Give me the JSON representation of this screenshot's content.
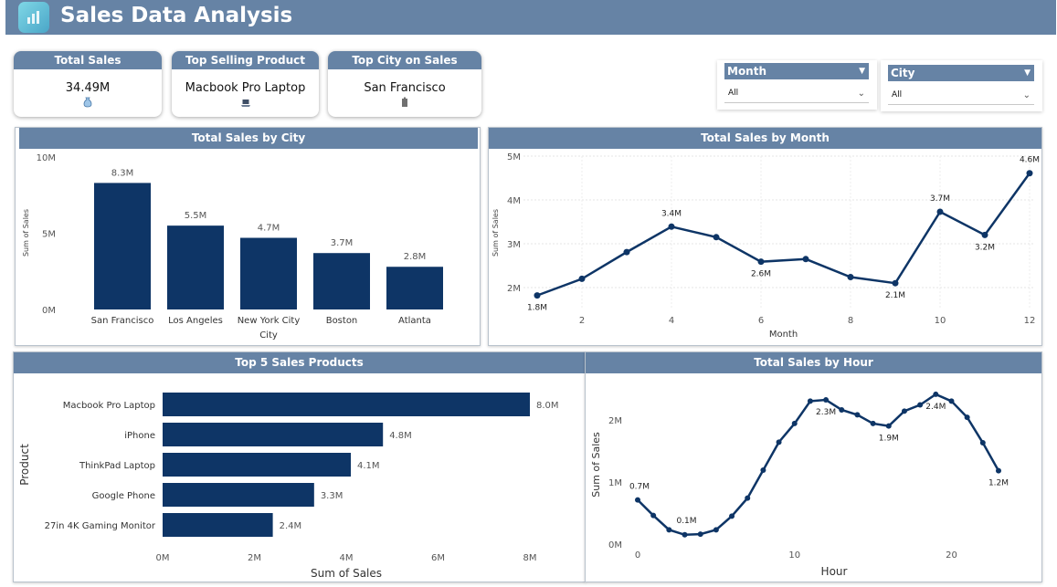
{
  "header": {
    "title": "Sales Data Analysis",
    "logo_icon": "analytics-logo-icon"
  },
  "kpis": [
    {
      "title": "Total Sales",
      "value": "34.49M",
      "icon": "money-bag-icon"
    },
    {
      "title": "Top Selling Product",
      "value": "Macbook Pro Laptop",
      "icon": "laptop-icon"
    },
    {
      "title": "Top City on Sales",
      "value": "San Francisco",
      "icon": "building-icon"
    }
  ],
  "filters": {
    "month": {
      "label": "Month",
      "value": "All"
    },
    "city": {
      "label": "City",
      "value": "All"
    }
  },
  "colors": {
    "header": "#6683a5",
    "bar": "#0e3566",
    "line": "#0e3566"
  },
  "chart_data": [
    {
      "type": "bar",
      "title": "Total Sales by City",
      "xlabel": "City",
      "ylabel": "Sum of Sales",
      "categories": [
        "San Francisco",
        "Los Angeles",
        "New York City",
        "Boston",
        "Atlanta"
      ],
      "values": [
        8.3,
        5.5,
        4.7,
        3.7,
        2.8
      ],
      "data_labels": [
        "8.3M",
        "5.5M",
        "4.7M",
        "3.7M",
        "2.8M"
      ],
      "ylim": [
        0,
        10
      ],
      "yticks": [
        0,
        5,
        10
      ],
      "ytick_labels": [
        "0M",
        "5M",
        "10M"
      ]
    },
    {
      "type": "line",
      "title": "Total Sales by Month",
      "xlabel": "Month",
      "ylabel": "Sum of Sales",
      "x": [
        1,
        2,
        3,
        4,
        5,
        6,
        7,
        8,
        9,
        10,
        11,
        12
      ],
      "values": [
        1.82,
        2.2,
        2.81,
        3.39,
        3.15,
        2.59,
        2.65,
        2.24,
        2.1,
        3.73,
        3.2,
        4.61
      ],
      "point_labels": {
        "1": "1.8M",
        "4": "3.4M",
        "6": "2.6M",
        "9": "2.1M",
        "10": "3.7M",
        "11": "3.2M",
        "12": "4.6M"
      },
      "xticks": [
        2,
        4,
        6,
        8,
        10,
        12
      ],
      "yticks": [
        2,
        3,
        4,
        5
      ],
      "ytick_labels": [
        "2M",
        "3M",
        "4M",
        "5M"
      ],
      "xlim": [
        1,
        12
      ],
      "ylim": [
        1.5,
        5
      ]
    },
    {
      "type": "bar",
      "orientation": "horizontal",
      "title": "Top 5 Sales Products",
      "xlabel": "Sum of Sales",
      "ylabel": "Product",
      "categories": [
        "Macbook Pro Laptop",
        "iPhone",
        "ThinkPad Laptop",
        "Google Phone",
        "27in 4K Gaming Monitor"
      ],
      "values": [
        8.0,
        4.8,
        4.1,
        3.3,
        2.4
      ],
      "data_labels": [
        "8.0M",
        "4.8M",
        "4.1M",
        "3.3M",
        "2.4M"
      ],
      "xlim": [
        0,
        8
      ],
      "xticks": [
        0,
        2,
        4,
        6,
        8
      ],
      "xtick_labels": [
        "0M",
        "2M",
        "4M",
        "6M",
        "8M"
      ]
    },
    {
      "type": "line",
      "title": "Total Sales by Hour",
      "xlabel": "Hour",
      "ylabel": "Sum of Sales",
      "x": [
        0,
        1,
        2,
        3,
        4,
        5,
        6,
        7,
        8,
        9,
        10,
        11,
        12,
        13,
        14,
        15,
        16,
        17,
        18,
        19,
        20,
        21,
        22,
        23
      ],
      "values": [
        0.71,
        0.46,
        0.23,
        0.15,
        0.16,
        0.23,
        0.45,
        0.74,
        1.19,
        1.64,
        1.94,
        2.3,
        2.32,
        2.16,
        2.08,
        1.94,
        1.9,
        2.14,
        2.24,
        2.41,
        2.3,
        2.04,
        1.63,
        1.18
      ],
      "point_labels": {
        "0": "0.7M",
        "3": "0.1M",
        "12": "2.3M",
        "16": "1.9M",
        "19": "2.4M",
        "23": "1.2M"
      },
      "xticks": [
        0,
        10,
        20
      ],
      "yticks": [
        0,
        1,
        2
      ],
      "ytick_labels": [
        "0M",
        "1M",
        "2M"
      ],
      "xlim": [
        0,
        23
      ],
      "ylim": [
        0,
        2.6
      ]
    }
  ]
}
